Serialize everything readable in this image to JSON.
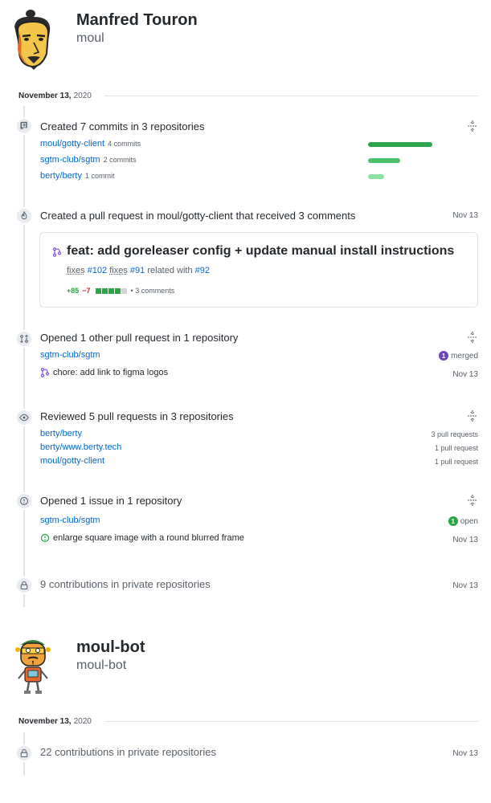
{
  "users": [
    {
      "name": "Manfred Touron",
      "login": "moul"
    },
    {
      "name": "moul-bot",
      "login": "moul-bot"
    }
  ],
  "date1": {
    "month_day": "November 13,",
    "year": "2020"
  },
  "date2": {
    "month_day": "November 13,",
    "year": "2020"
  },
  "commits": {
    "summary": "Created 7 commits in 3 repositories",
    "repos": [
      {
        "name": "moul/gotty-client",
        "count": "4 commits",
        "fraction": 1.0
      },
      {
        "name": "sgtm-club/sgtm",
        "count": "2 commits",
        "fraction": 0.5
      },
      {
        "name": "berty/berty",
        "count": "1 commit",
        "fraction": 0.25
      }
    ],
    "bar_colors": [
      "#2da44e",
      "#4ac26b",
      "#8fe1a1"
    ]
  },
  "pr": {
    "summary": "Created a pull request in moul/gotty-client that received 3 comments",
    "date": "Nov 13",
    "title": "feat: add goreleaser config + update manual install instructions",
    "refs": {
      "w1": "fixes",
      "r1": "#102",
      "w2": "fixes",
      "r2": "#91",
      "w3": "related with",
      "r3": "#92"
    },
    "additions": "+85",
    "deletions": "−7",
    "comments": "• 3 comments"
  },
  "other_pr": {
    "summary": "Opened 1 other pull request in 1 repository",
    "repo": "sgtm-club/sgtm",
    "badge_count": "1",
    "badge_label": "merged",
    "item": "chore: add link to figma logos",
    "date": "Nov 13"
  },
  "reviews": {
    "summary": "Reviewed 5 pull requests in 3 repositories",
    "repos": [
      {
        "name": "berty/berty",
        "count": "3 pull requests"
      },
      {
        "name": "berty/www.berty.tech",
        "count": "1 pull request"
      },
      {
        "name": "moul/gotty-client",
        "count": "1 pull request"
      }
    ]
  },
  "issue": {
    "summary": "Opened 1 issue in 1 repository",
    "repo": "sgtm-club/sgtm",
    "badge_count": "1",
    "badge_label": "open",
    "item": "enlarge square image with a round blurred frame",
    "date": "Nov 13"
  },
  "private1": {
    "summary": "9 contributions in private repositories",
    "date": "Nov 13"
  },
  "private2": {
    "summary": "22 contributions in private repositories",
    "date": "Nov 13"
  }
}
